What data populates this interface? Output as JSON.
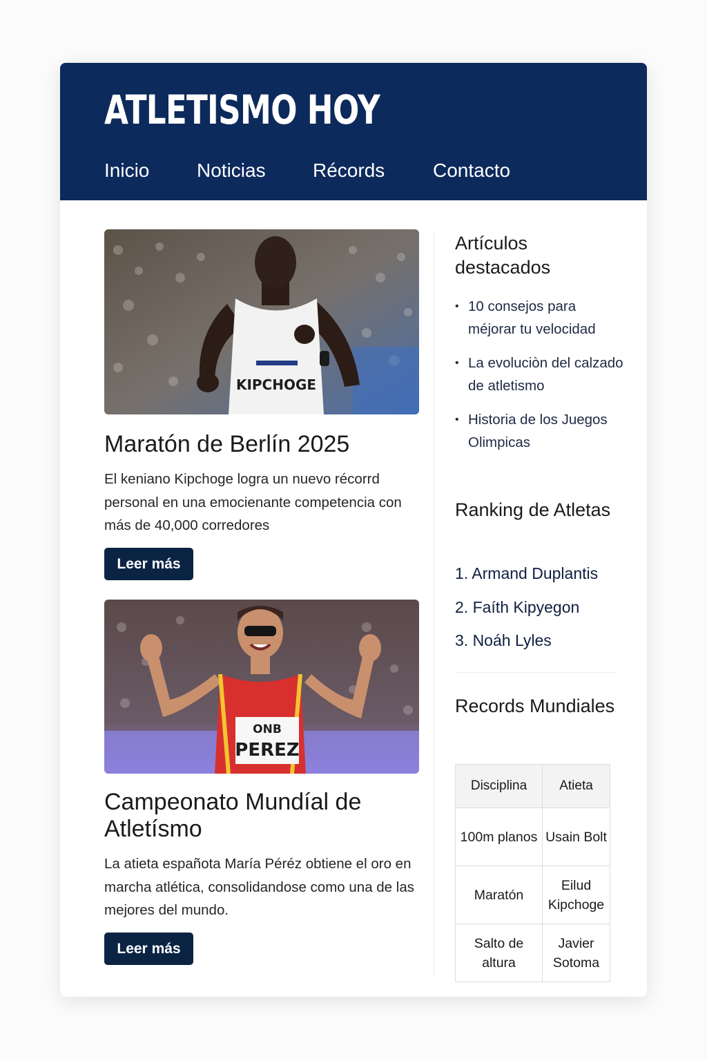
{
  "site": {
    "title": "ATLETISMO HOY"
  },
  "nav": [
    {
      "label": "Inicio"
    },
    {
      "label": "Noticias"
    },
    {
      "label": "Récords"
    },
    {
      "label": "Contacto"
    }
  ],
  "articles": [
    {
      "bib_name": "KIPCHOGE",
      "title": "Maratón de Berlín 2025",
      "description": "El keniano Kipchoge logra un nuevo récorrd personal en una emocienante competencia con más de 40,000 corredores",
      "button_label": "Leer más"
    },
    {
      "bib_brand": "ONB",
      "bib_name": "PEREZ",
      "title": "Campeonato Mundíal de Atletísmo",
      "description": "La atieta españota María Péréz obtiene el oro en marcha atlética, consolidandose como una de las mejores del mundo.",
      "button_label": "Leer más"
    }
  ],
  "sidebar": {
    "featured": {
      "heading": "Artículos destacados",
      "items": [
        {
          "label": "10 consejos para méjorar tu velocidad"
        },
        {
          "label": "La evoluciòn del calzado de atletismo"
        },
        {
          "label": "Historia de los Juegos Olimpicas"
        }
      ]
    },
    "ranking": {
      "heading": "Ranking de Atletas",
      "items": [
        {
          "label": "1. Armand Duplantis"
        },
        {
          "label": "2. Faíth Kipyegon"
        },
        {
          "label": "3. Noáh Lyles"
        }
      ]
    },
    "records": {
      "heading": "Records Mundiales",
      "columns": [
        "Disciplina",
        "Atieta"
      ],
      "rows": [
        [
          "100m planos",
          "Usain Bolt"
        ],
        [
          "Maratón",
          "Eilud Kipchoge"
        ],
        [
          "Salto de altura",
          "Javier Sotoma"
        ]
      ]
    }
  },
  "colors": {
    "header_bg": "#0d2a5c",
    "button_bg": "#0c2444",
    "page_bg": "#fbfbfb",
    "card_bg": "#ffffff"
  }
}
